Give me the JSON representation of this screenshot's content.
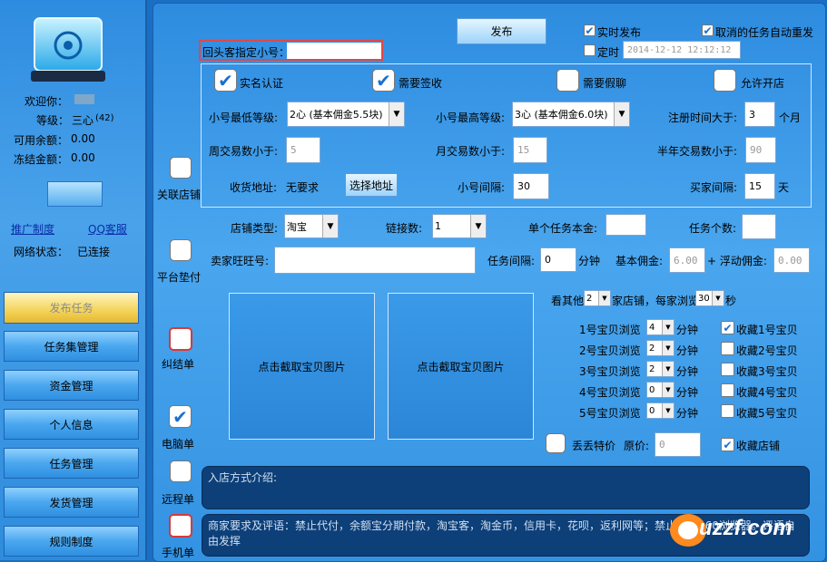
{
  "sidebar": {
    "welcome_label": "欢迎你：",
    "level_label": "等级：",
    "level_value": "三心",
    "level_count": "(42)",
    "available_label": "可用余额：",
    "available_value": "0.00",
    "frozen_label": "冻结金额：",
    "frozen_value": "0.00",
    "promo_link": "推广制度",
    "qq_link": "QQ客服",
    "net_label": "网络状态：",
    "net_value": "已连接",
    "menu": [
      "发布任务",
      "任务集管理",
      "资金管理",
      "个人信息",
      "任务管理",
      "发货管理",
      "规则制度"
    ]
  },
  "top": {
    "publish_btn": "发布",
    "realtime_label": "实时发布",
    "auto_repost_label": "取消的任务自动重发",
    "timed_label": "定时",
    "timed_value": "2014-12-12 12:12:12",
    "return_customer_label": "回头客指定小号："
  },
  "requirements": {
    "realname": "实名认证",
    "sign": "需要签收",
    "fakechat": "需要假聊",
    "shop": "允许开店",
    "min_level_label": "小号最低等级:",
    "min_level_value": "2心 (基本佣金5.5块)",
    "max_level_label": "小号最高等级:",
    "max_level_value": "3心 (基本佣金6.0块)",
    "reg_time_label": "注册时间大于:",
    "reg_time_value": "3",
    "reg_time_unit": "个月",
    "week_label": "周交易数小于:",
    "week_value": "5",
    "month_label": "月交易数小于:",
    "month_value": "15",
    "half_year_label": "半年交易数小于:",
    "half_year_value": "90",
    "addr_label": "收货地址:",
    "addr_value": "无要求",
    "addr_btn": "选择地址",
    "gap_label": "小号间隔:",
    "gap_value": "30",
    "buyer_gap_label": "买家间隔:",
    "buyer_gap_value": "15",
    "buyer_gap_unit": "天"
  },
  "left_options": {
    "link_shop": "关联店铺",
    "platform_pay": "平台垫付",
    "dispute": "纠结单",
    "pc": "电脑单",
    "remote": "远程单",
    "mobile": "手机单"
  },
  "shop": {
    "type_label": "店铺类型:",
    "type_value": "淘宝",
    "links_label": "链接数:",
    "links_value": "1",
    "principal_label": "单个任务本金:",
    "count_label": "任务个数:",
    "wangwang_label": "卖家旺旺号:",
    "interval_label": "任务间隔:",
    "interval_value": "0",
    "interval_unit": "分钟",
    "base_fee_label": "基本佣金:",
    "base_fee_value": "6.00",
    "float_fee_label": "+ 浮动佣金:",
    "float_fee_value": "0.00"
  },
  "pics": [
    "点击截取宝贝图片",
    "点击截取宝贝图片"
  ],
  "browse": {
    "other_prefix": "看其他",
    "other_shops": "2",
    "other_mid": "家店铺，每家浏览",
    "other_secs": "30",
    "other_suffix": "秒",
    "items": [
      {
        "label": "1号宝贝浏览",
        "value": "4",
        "unit": "分钟",
        "fav": "收藏1号宝贝",
        "checked": true
      },
      {
        "label": "2号宝贝浏览",
        "value": "2",
        "unit": "分钟",
        "fav": "收藏2号宝贝",
        "checked": false
      },
      {
        "label": "3号宝贝浏览",
        "value": "2",
        "unit": "分钟",
        "fav": "收藏3号宝贝",
        "checked": false
      },
      {
        "label": "4号宝贝浏览",
        "value": "0",
        "unit": "分钟",
        "fav": "收藏4号宝贝",
        "checked": false
      },
      {
        "label": "5号宝贝浏览",
        "value": "0",
        "unit": "分钟",
        "fav": "收藏5号宝贝",
        "checked": false
      }
    ],
    "special_price": "丢丢特价",
    "orig_price_label": "原价:",
    "orig_price_value": "0",
    "fav_shop": "收藏店铺"
  },
  "notes": {
    "entry_label": "入店方式介绍:",
    "merchant_text": "商家要求及评语：禁止代付，余额宝分期付款，淘宝客，淘金币，信用卡，花呗，返利网等；禁止使用360浏览器。评语自由发挥"
  },
  "watermark": "uzzf.com"
}
